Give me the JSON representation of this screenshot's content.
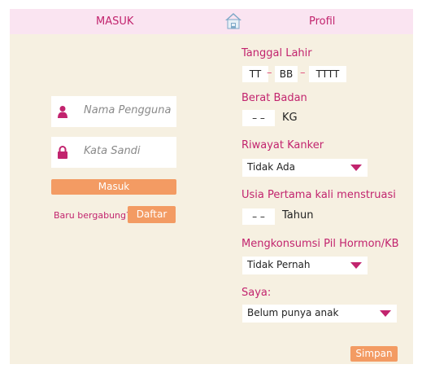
{
  "topbar": {
    "login_tab": "MASUK",
    "profile_tab": "Profil"
  },
  "login": {
    "username_placeholder": "Nama Pengguna",
    "password_placeholder": "Kata Sandi",
    "login_button": "Masuk",
    "new_user_text": "Baru bergabung?",
    "register_button": "Daftar"
  },
  "profile": {
    "birthdate_label": "Tanggal Lahir",
    "day": "TT",
    "month": "BB",
    "year": "TTTT",
    "date_separator": "–",
    "weight_label": "Berat Badan",
    "weight_value": "– –",
    "weight_unit": "KG",
    "cancer_history_label": "Riwayat Kanker",
    "cancer_history_value": "Tidak Ada",
    "menarche_label": "Usia Pertama kali menstruasi",
    "menarche_value": "– –",
    "menarche_unit": "Tahun",
    "hormone_pill_label": "Mengkonsumsi Pil Hormon/KB",
    "hormone_pill_value": "Tidak Pernah",
    "self_label": "Saya:",
    "self_value": "Belum punya anak",
    "save_button": "Simpan"
  },
  "colors": {
    "accent": "#c2246e",
    "button": "#f39b63",
    "panel": "#f6f0e1",
    "topbar": "#fae4f1"
  }
}
